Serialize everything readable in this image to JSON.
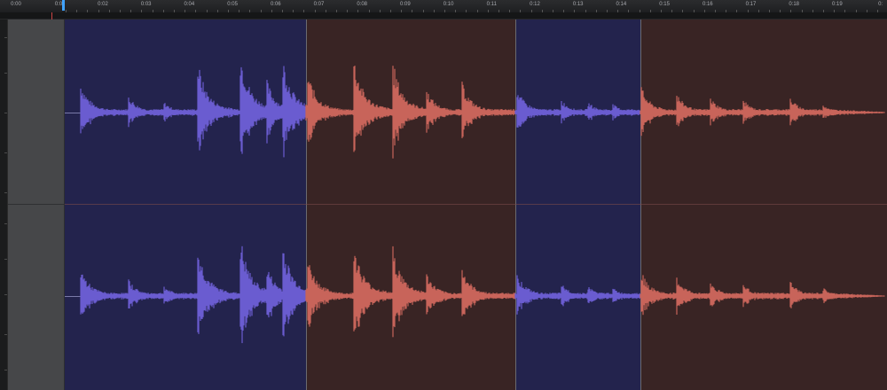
{
  "ruler": {
    "start_label": "0:00",
    "playhead_label": "0:0",
    "ticks": [
      "0:02",
      "0:03",
      "0:04",
      "0:05",
      "0:06",
      "0:07",
      "0:08",
      "0:09",
      "0:10",
      "0:11",
      "0:12",
      "0:13",
      "0:14",
      "0:15",
      "0:16",
      "0:17",
      "0:18",
      "0:19",
      "0:"
    ]
  },
  "colors": {
    "blue_clip_bg": "#23234d",
    "red_clip_bg": "#392424",
    "blue_wave": "#6a5cd0",
    "red_wave": "#c8645a",
    "playhead": "#3fa2ff"
  },
  "clips": [
    {
      "color": "blue"
    },
    {
      "color": "red"
    },
    {
      "color": "blue"
    },
    {
      "color": "red"
    }
  ]
}
